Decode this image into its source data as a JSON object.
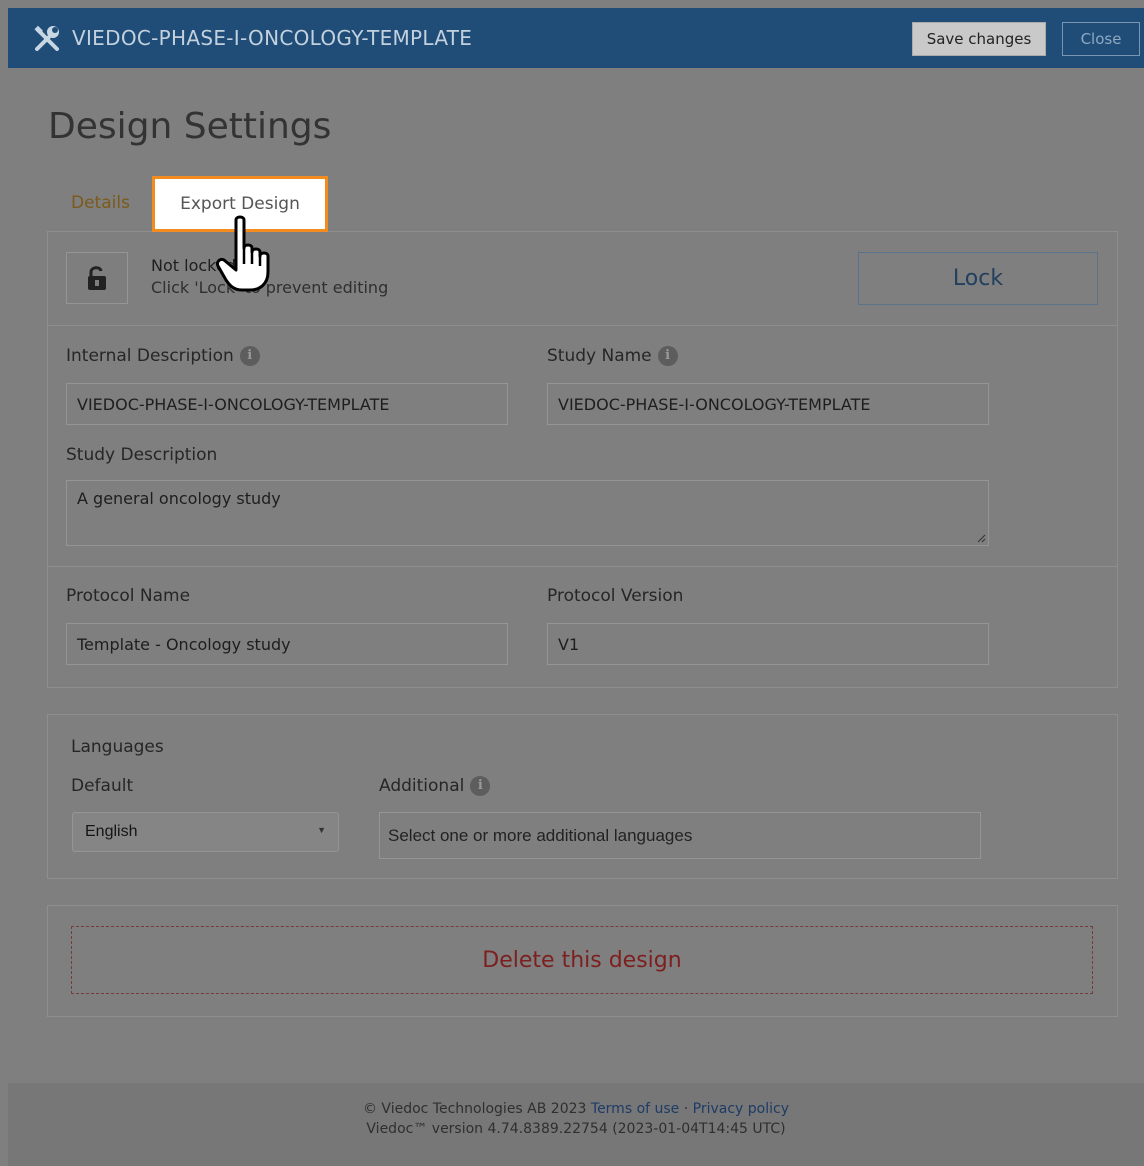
{
  "header": {
    "title": "VIEDOC-PHASE-I-ONCOLOGY-TEMPLATE",
    "save_label": "Save changes",
    "close_label": "Close"
  },
  "page": {
    "title": "Design Settings"
  },
  "tabs": [
    {
      "label": "Details"
    },
    {
      "label": "Export Design"
    }
  ],
  "lock": {
    "status": "Not locked",
    "hint": "Click 'Lock' to prevent editing",
    "button_label": "Lock"
  },
  "fields": {
    "internal_description": {
      "label": "Internal Description",
      "value": "VIEDOC-PHASE-I-ONCOLOGY-TEMPLATE"
    },
    "study_name": {
      "label": "Study Name",
      "value": "VIEDOC-PHASE-I-ONCOLOGY-TEMPLATE"
    },
    "study_description": {
      "label": "Study Description",
      "value": "A general oncology study"
    },
    "protocol_name": {
      "label": "Protocol Name",
      "value": "Template - Oncology study"
    },
    "protocol_version": {
      "label": "Protocol Version",
      "value": "V1"
    }
  },
  "languages": {
    "heading": "Languages",
    "default_label": "Default",
    "default_value": "English",
    "additional_label": "Additional",
    "additional_placeholder": "Select one or more additional languages"
  },
  "danger": {
    "delete_label": "Delete this design"
  },
  "footer": {
    "copyright": "© Viedoc Technologies AB 2023",
    "terms": "Terms of use",
    "separator": "·",
    "privacy": "Privacy policy",
    "version": "Viedoc™ version 4.74.8389.22754 (2023-01-04T14:45 UTC)"
  },
  "colors": {
    "header_bg": "#1f4d78",
    "tab_highlight": "#f28c1e",
    "delete_text": "#7d1f1f"
  }
}
